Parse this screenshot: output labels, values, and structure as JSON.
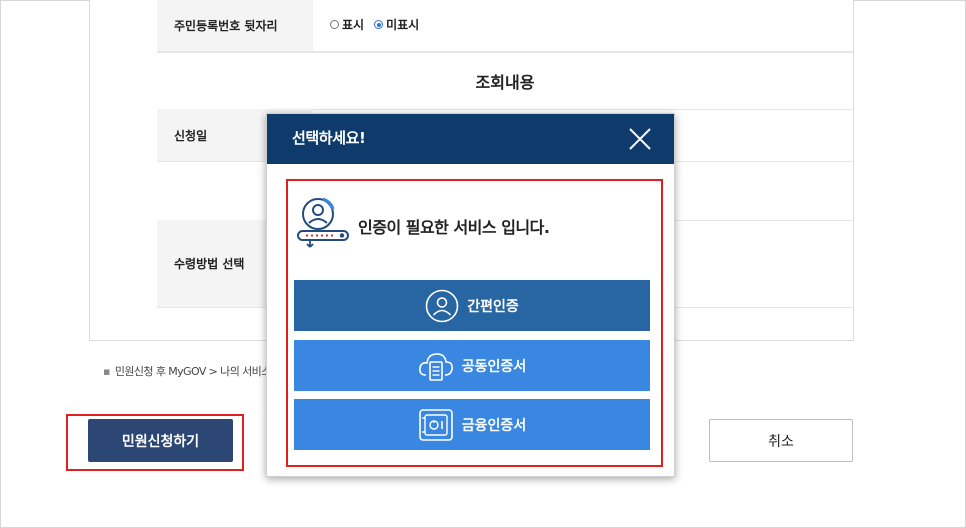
{
  "form": {
    "resident_row_label": "주민등록번호 뒷자리",
    "radio_show_label": "표시",
    "radio_hide_label": "미표시",
    "section_title": "조회내용",
    "apply_date_label": "신청일",
    "receive_method_label": "수령방법 선택",
    "note_text": "민원신청 후 MyGOV > 나의 서비스"
  },
  "actions": {
    "apply_label": "민원신청하기",
    "cancel_label": "취소"
  },
  "modal": {
    "title": "선택하세요!",
    "message": "인증이 필요한 서비스 입니다.",
    "options": [
      {
        "label": "간편인증",
        "icon": "person-circle-icon"
      },
      {
        "label": "공동인증서",
        "icon": "cloud-document-icon"
      },
      {
        "label": "금융인증서",
        "icon": "safe-icon"
      }
    ]
  },
  "colors": {
    "header_navy": "#0f3b6c",
    "simple_btn": "#2765a3",
    "cert_btn": "#3a87e1",
    "apply_btn": "#2c4773",
    "highlight_red": "#e0201f"
  }
}
